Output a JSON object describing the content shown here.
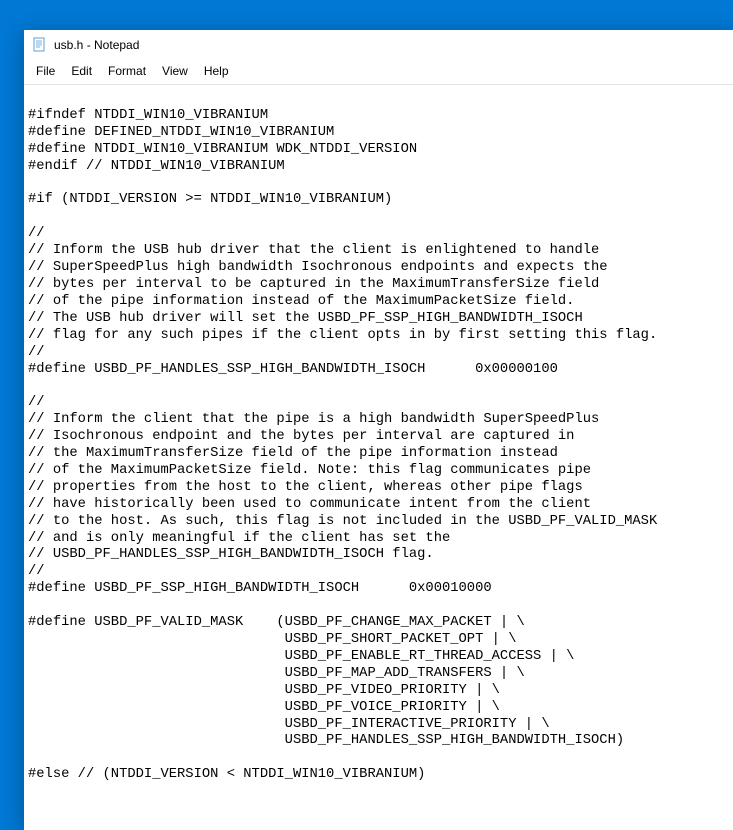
{
  "window": {
    "title": "usb.h - Notepad"
  },
  "menu": {
    "file": "File",
    "edit": "Edit",
    "format": "Format",
    "view": "View",
    "help": "Help"
  },
  "editor": {
    "content": "\n#ifndef NTDDI_WIN10_VIBRANIUM\n#define DEFINED_NTDDI_WIN10_VIBRANIUM\n#define NTDDI_WIN10_VIBRANIUM WDK_NTDDI_VERSION\n#endif // NTDDI_WIN10_VIBRANIUM\n\n#if (NTDDI_VERSION >= NTDDI_WIN10_VIBRANIUM)\n\n//\n// Inform the USB hub driver that the client is enlightened to handle\n// SuperSpeedPlus high bandwidth Isochronous endpoints and expects the\n// bytes per interval to be captured in the MaximumTransferSize field\n// of the pipe information instead of the MaximumPacketSize field.\n// The USB hub driver will set the USBD_PF_SSP_HIGH_BANDWIDTH_ISOCH\n// flag for any such pipes if the client opts in by first setting this flag.\n//\n#define USBD_PF_HANDLES_SSP_HIGH_BANDWIDTH_ISOCH      0x00000100\n\n//\n// Inform the client that the pipe is a high bandwidth SuperSpeedPlus\n// Isochronous endpoint and the bytes per interval are captured in\n// the MaximumTransferSize field of the pipe information instead\n// of the MaximumPacketSize field. Note: this flag communicates pipe\n// properties from the host to the client, whereas other pipe flags\n// have historically been used to communicate intent from the client\n// to the host. As such, this flag is not included in the USBD_PF_VALID_MASK\n// and is only meaningful if the client has set the\n// USBD_PF_HANDLES_SSP_HIGH_BANDWIDTH_ISOCH flag.\n//\n#define USBD_PF_SSP_HIGH_BANDWIDTH_ISOCH      0x00010000\n\n#define USBD_PF_VALID_MASK    (USBD_PF_CHANGE_MAX_PACKET | \\\n                               USBD_PF_SHORT_PACKET_OPT | \\\n                               USBD_PF_ENABLE_RT_THREAD_ACCESS | \\\n                               USBD_PF_MAP_ADD_TRANSFERS | \\\n                               USBD_PF_VIDEO_PRIORITY | \\\n                               USBD_PF_VOICE_PRIORITY | \\\n                               USBD_PF_INTERACTIVE_PRIORITY | \\\n                               USBD_PF_HANDLES_SSP_HIGH_BANDWIDTH_ISOCH)\n\n#else // (NTDDI_VERSION < NTDDI_WIN10_VIBRANIUM)"
  }
}
